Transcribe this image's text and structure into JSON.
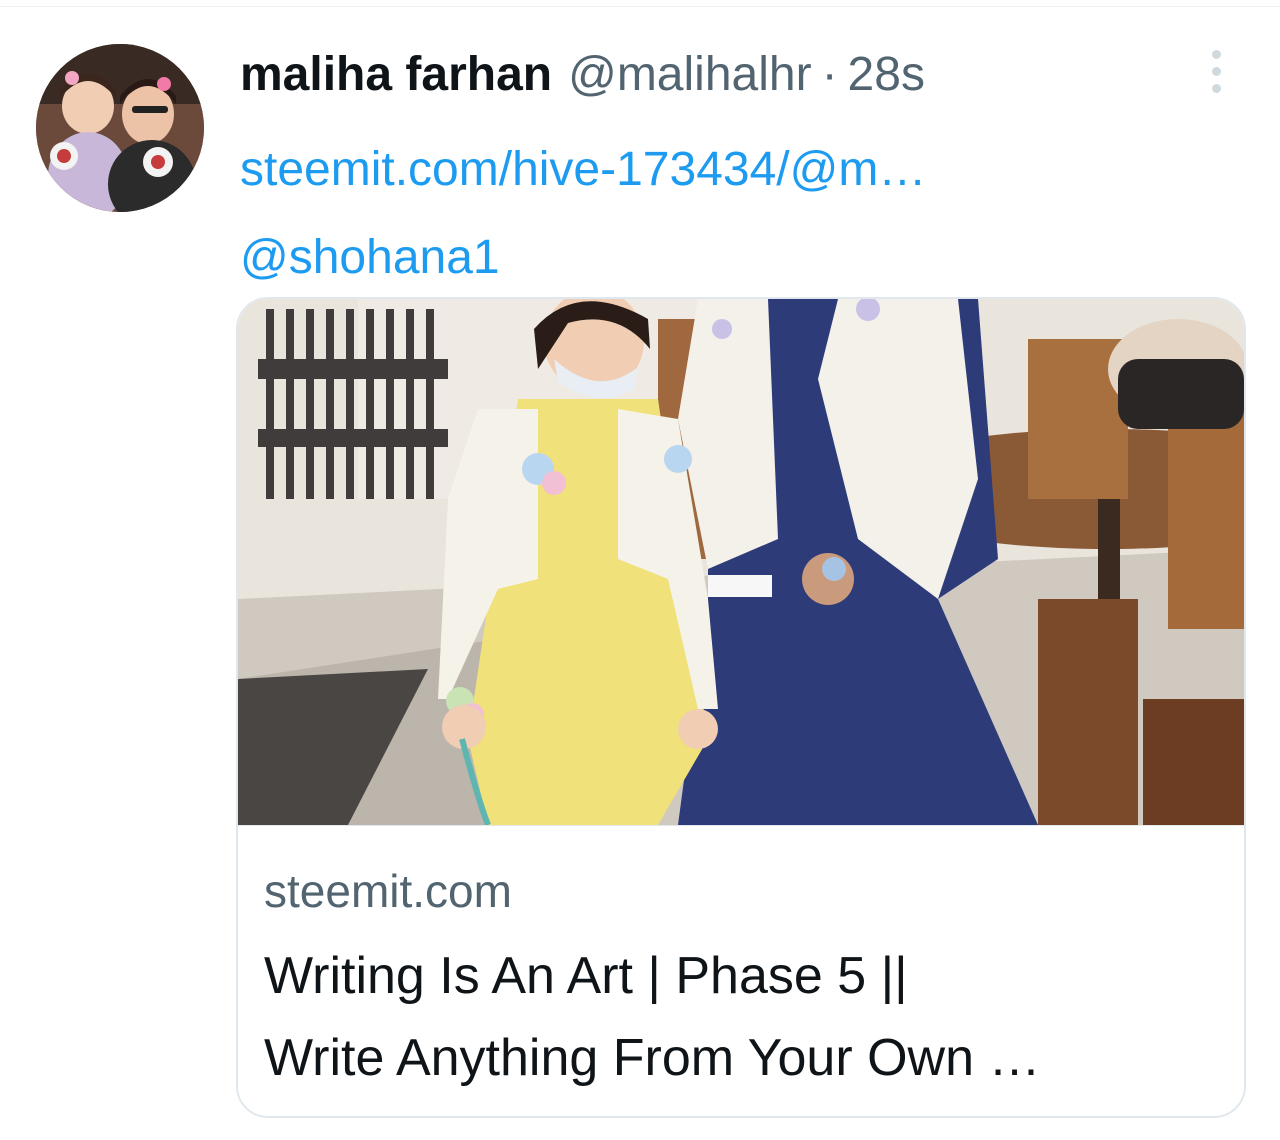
{
  "tweet": {
    "display_name": "maliha farhan",
    "handle": "@malihalhr",
    "separator": "·",
    "timestamp": "28s",
    "link_text": "steemit.com/hive-173434/@m…",
    "mention": "@shohana1",
    "avatar_icon": "profile-photo",
    "more_icon": "more-vertical-icon"
  },
  "card": {
    "domain": "steemit.com",
    "title_line1": "Writing Is An Art | Phase 5 ||",
    "title_line2": "Write Anything From Your Own …"
  },
  "colors": {
    "link": "#1d9bf0",
    "primary_text": "#0f1419",
    "secondary_text": "#536471",
    "border": "#e1e8ed"
  }
}
